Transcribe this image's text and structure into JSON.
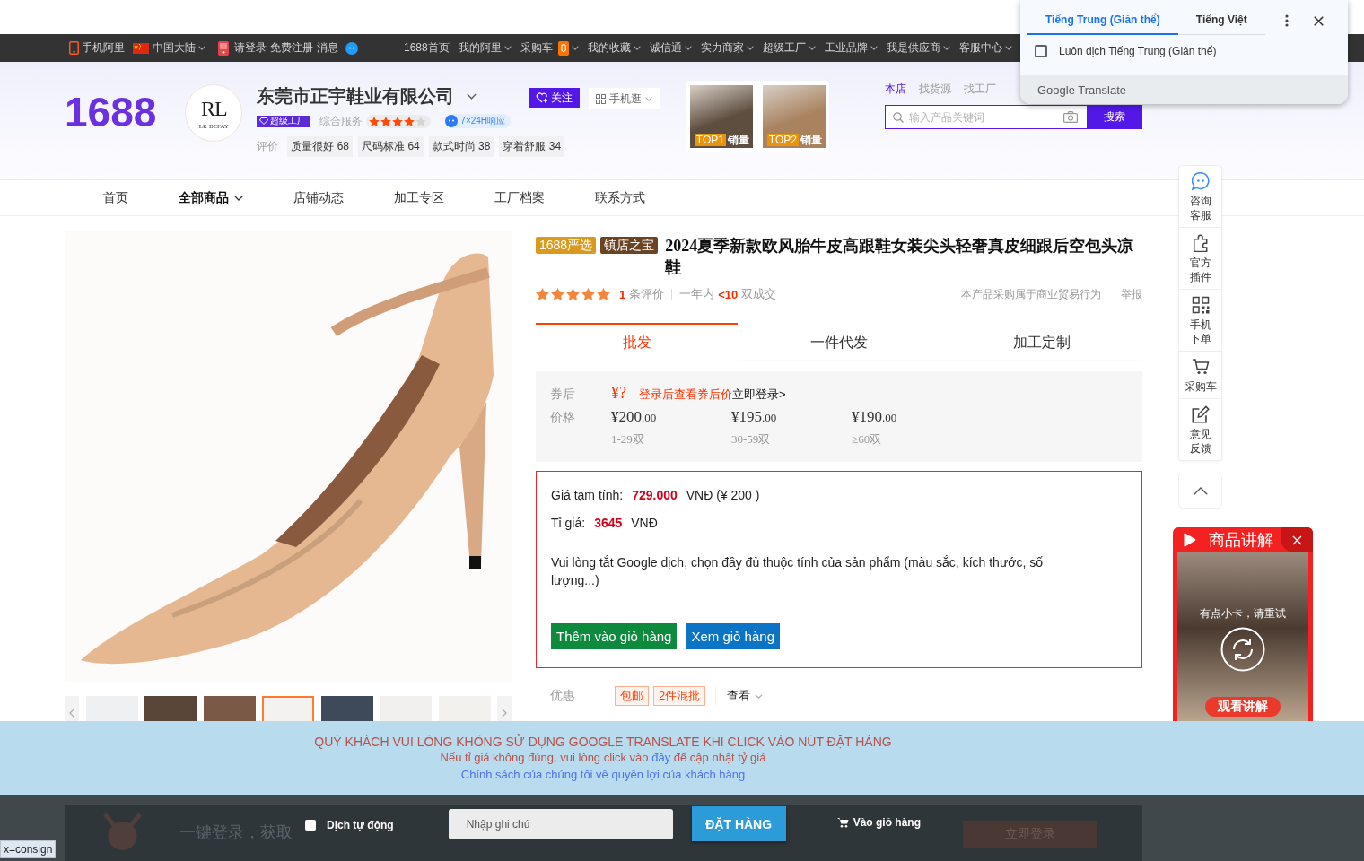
{
  "top_nav": {
    "mobile": "手机阿里",
    "region": {
      "label": "中国大陆",
      "dropdown": true
    },
    "login": "请登录",
    "register": "免费注册",
    "messages": "消息",
    "links": [
      {
        "label": "1688首页",
        "dropdown": false
      },
      {
        "label": "我的阿里",
        "dropdown": true
      },
      {
        "label": "采购车",
        "badge": "0",
        "dropdown": true
      },
      {
        "label": "我的收藏",
        "dropdown": true
      },
      {
        "label": "诚信通",
        "dropdown": true
      },
      {
        "label": "实力商家",
        "dropdown": true
      },
      {
        "label": "超级工厂",
        "dropdown": true
      },
      {
        "label": "工业品牌",
        "dropdown": true
      },
      {
        "label": "我是供应商",
        "dropdown": true
      },
      {
        "label": "客服中心",
        "dropdown": true
      }
    ]
  },
  "translate_popup": {
    "tabs": [
      {
        "label": "Tiếng Trung (Giản thể)",
        "selected": true
      },
      {
        "label": "Tiếng Việt",
        "selected": false
      }
    ],
    "always_translate": {
      "label": "Luôn dịch Tiếng Trung (Giản thể)",
      "checked": false
    },
    "footer": "Google Translate"
  },
  "store_header": {
    "logo": "1688",
    "store_logo": {
      "monogram": "RL",
      "caption": "LR·BEFAY"
    },
    "company": "东莞市正宇鞋业有限公司",
    "factory_badge": "超级工厂",
    "service_label": "综合服务",
    "stars": 4,
    "response_badge": "7×24H响应",
    "review_label": "评价",
    "review_tags": [
      {
        "label": "质量很好",
        "count": "68"
      },
      {
        "label": "尺码标准",
        "count": "64"
      },
      {
        "label": "款式时尚",
        "count": "38"
      },
      {
        "label": "穿着舒服",
        "count": "34"
      }
    ],
    "follow_button": "关注",
    "mobile_button": "手机逛",
    "top_products": [
      {
        "rank": "TOP1",
        "label": "销量"
      },
      {
        "rank": "TOP2",
        "label": "销量"
      }
    ],
    "search": {
      "tabs": [
        {
          "label": "本店",
          "selected": true
        },
        {
          "label": "找货源",
          "selected": false
        },
        {
          "label": "找工厂",
          "selected": false
        }
      ],
      "placeholder": "输入产品关键词",
      "button": "搜索"
    }
  },
  "store_nav": [
    {
      "label": "首页",
      "selected": false,
      "dropdown": false
    },
    {
      "label": "全部商品",
      "selected": true,
      "dropdown": true
    },
    {
      "label": "店铺动态",
      "selected": false,
      "dropdown": false
    },
    {
      "label": "加工专区",
      "selected": false,
      "dropdown": false
    },
    {
      "label": "工厂档案",
      "selected": false,
      "dropdown": false
    },
    {
      "label": "联系方式",
      "selected": false,
      "dropdown": false
    }
  ],
  "gallery": {
    "thumbnails": [
      {
        "selected": false
      },
      {
        "selected": false
      },
      {
        "selected": false
      },
      {
        "selected": true
      },
      {
        "selected": false
      },
      {
        "selected": false
      },
      {
        "selected": false
      }
    ]
  },
  "product": {
    "badges": [
      {
        "label": "1688严选",
        "color": "#d99a1e"
      },
      {
        "label": "镇店之宝",
        "color": "#6b4424"
      }
    ],
    "title": "2024夏季新款欧风胎牛皮高跟鞋女装尖头轻奢真皮细跟后空包头凉鞋",
    "stars": 5,
    "review_count": "1",
    "review_label": "条评价",
    "sales_prefix": "一年内",
    "sales_count": "<10",
    "sales_suffix": "双成交",
    "trade_notice": "本产品采购属于商业贸易行为",
    "report": "举报",
    "mode_tabs": [
      {
        "label": "批发",
        "selected": true
      },
      {
        "label": "一件代发",
        "selected": false
      },
      {
        "label": "加工定制",
        "selected": false
      }
    ],
    "coupon": {
      "label": "券后",
      "price": "¥?",
      "hint": "登录后查看券后价",
      "login": "立即登录>"
    },
    "price_label": "价格",
    "price_tiers": [
      {
        "price": "¥200.00",
        "range": "1-29双"
      },
      {
        "price": "¥195.00",
        "range": "30-59双"
      },
      {
        "price": "¥190.00",
        "range": "≥60双"
      }
    ]
  },
  "estimate": {
    "price_label": "Giá tạm tính:",
    "price_value": "729.000",
    "price_suffix": "VNĐ (¥ 200 )",
    "rate_label": "Tỉ giá:",
    "rate_value": "3645",
    "rate_suffix": "VNĐ",
    "message": "Vui lòng tắt Google dịch, chọn đầy đủ thuộc tính của sản phẩm (màu sắc, kích thước, số lượng...)",
    "buttons": [
      {
        "label": "Thêm vào giỏ hàng",
        "color": "#0d8a3e"
      },
      {
        "label": "Xem giỏ hàng",
        "color": "#0b74c4"
      }
    ]
  },
  "promotions": {
    "label": "优惠",
    "tags": [
      "包邮",
      "2件混批"
    ],
    "more": "查看"
  },
  "side_toolbar": {
    "items": [
      "咨询客服",
      "官方插件",
      "手机下单",
      "采购车",
      "意见反馈"
    ]
  },
  "video_widget": {
    "title": "商品讲解",
    "message": "有点小卡，请重试",
    "button": "观看讲解"
  },
  "notice_banner": {
    "warning": "QUÝ KHÁCH VUI LÒNG KHÔNG SỬ DỤNG GOOGLE TRANSLATE KHI CLICK VÀO NÚT ĐẶT HÀNG",
    "rate_prefix": "Nếu tỉ giá không đúng, vui lòng click vào",
    "rate_link": "đây",
    "rate_suffix": "để cập nhật tỷ giá",
    "policy_link": "Chính sách của chúng tôi về quyền lợi của khách hàng"
  },
  "order_bar": {
    "login_prompt": "一键登录，获取",
    "auto_translate": {
      "label": "Dịch tự động",
      "checked": false
    },
    "note_placeholder": "Nhập ghi chú",
    "order_button": "ĐẶT HÀNG",
    "cart_button": "Vào giỏ hàng",
    "login_button": "立即登录"
  },
  "status_url": "x=consign"
}
